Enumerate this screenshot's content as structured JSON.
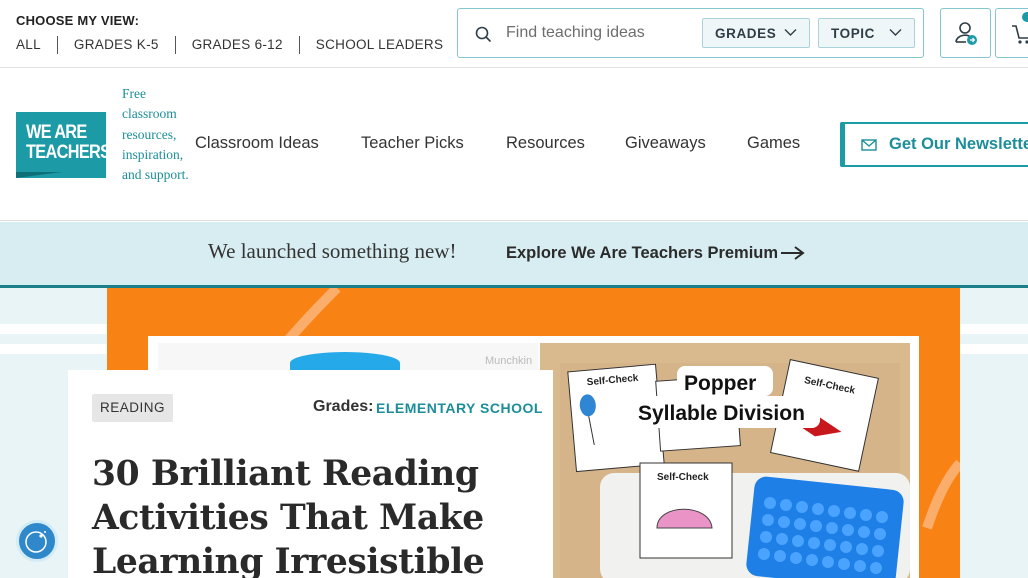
{
  "topbar": {
    "choose_label": "CHOOSE MY VIEW:",
    "views": [
      "ALL",
      "GRADES K-5",
      "GRADES 6-12",
      "SCHOOL LEADERS"
    ]
  },
  "search": {
    "placeholder": "Find teaching ideas",
    "grades_label": "GRADES",
    "topic_label": "TOPIC"
  },
  "logo": {
    "line1": "WE ARE",
    "line2": "TEACHERS"
  },
  "tagline": "Free classroom resources, inspiration, and support.",
  "nav": {
    "classroom": "Classroom Ideas",
    "picks": "Teacher Picks",
    "resources": "Resources",
    "giveaways": "Giveaways",
    "games": "Games",
    "newsletter": "Get Our Newsletter"
  },
  "promo": {
    "text": "We launched something new!",
    "link": "Explore We Are Teachers Premium"
  },
  "article": {
    "category": "READING",
    "grades_label": "Grades:",
    "grades_value": "ELEMENTARY SCHOOL",
    "title": "30 Brilliant Reading Activities That Make Learning Irresistible"
  },
  "hero_image": {
    "watermark": "Munchkin",
    "card_label_1": "Self-Check",
    "card_label_2": "Self-Check",
    "card_label_3": "Self-Check",
    "caption_1": "Popper",
    "caption_2": "Syllable Division"
  },
  "colors": {
    "brand_teal": "#1c9aa5",
    "hero_orange": "#f98214",
    "promo_bg": "#d7edf1"
  }
}
